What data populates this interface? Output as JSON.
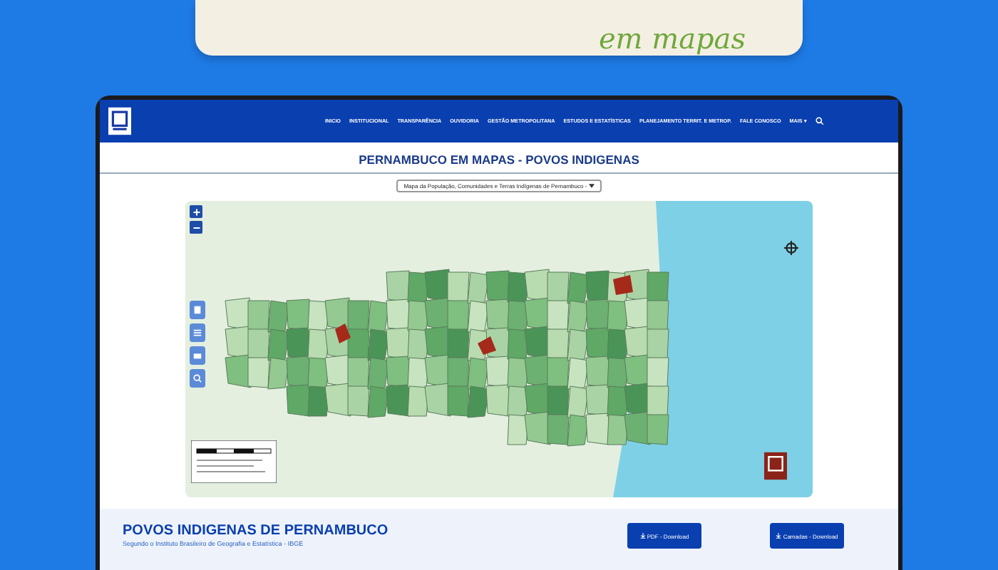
{
  "banner": {
    "text": "em mapas"
  },
  "nav": {
    "items": [
      "INICIO",
      "INSTITUCIONAL",
      "TRANSPARÊNCIA",
      "OUVIDORIA",
      "GESTÃO METROPOLITANA",
      "ESTUDOS E ESTATÍSTICAS",
      "PLANEJAMENTO TERRIT. E METROP.",
      "FALE CONOSCO",
      "MAIS ▾"
    ]
  },
  "page": {
    "title": "PERNAMBUCO EM MAPAS - POVOS INDIGENAS",
    "select": "Mapa da População, Comunidades e Terras Indígenas de Pernambuco -"
  },
  "section": {
    "title": "POVOS INDIGENAS DE PERNAMBUCO",
    "subtitle": "Segundo o Instituto Brasileiro de Geografia e Estatística - IBGE",
    "buttons": [
      "PDF - Download",
      "Camadas - Download"
    ]
  }
}
